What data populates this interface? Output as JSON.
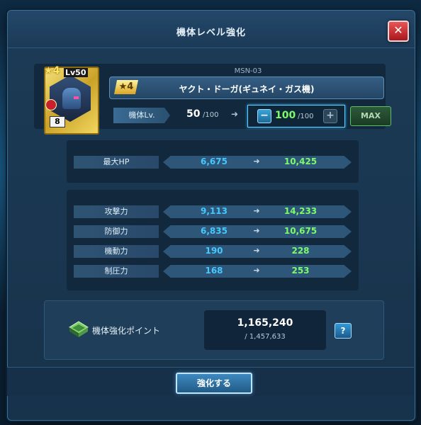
{
  "window": {
    "title": "機体レベル強化"
  },
  "unit": {
    "card_level": "Lv50",
    "card_rarity": "4",
    "card_count": "8",
    "model_code": "MSN-03",
    "rarity_label": "4",
    "name": "ヤクト・ドーガ(ギュネイ・ガス機)"
  },
  "level": {
    "label": "機体Lv.",
    "current": "50",
    "current_max": "/100",
    "arrow": "➜",
    "minus": "−",
    "new": "100",
    "new_max": "/100",
    "plus": "+",
    "max_button": "MAX"
  },
  "stats_hp": [
    {
      "label": "最大HP",
      "current": "6,675",
      "arrow": "➜",
      "new": "10,425"
    }
  ],
  "stats": [
    {
      "label": "攻撃力",
      "current": "9,113",
      "arrow": "➜",
      "new": "14,233"
    },
    {
      "label": "防御力",
      "current": "6,835",
      "arrow": "➜",
      "new": "10,675"
    },
    {
      "label": "機動力",
      "current": "190",
      "arrow": "➜",
      "new": "228"
    },
    {
      "label": "制圧力",
      "current": "168",
      "arrow": "➜",
      "new": "253"
    }
  ],
  "points": {
    "label": "機体強化ポイント",
    "current": "1,165,240",
    "total": "/ 1,457,633",
    "help": "?"
  },
  "footer": {
    "enhance_button": "強化する"
  },
  "icons": {
    "close": "close-icon",
    "chip": "chip-icon",
    "star": "star-icon"
  },
  "colors": {
    "current_value": "#45c8ff",
    "new_value": "#7cfb6a",
    "close": "#c81f26"
  }
}
